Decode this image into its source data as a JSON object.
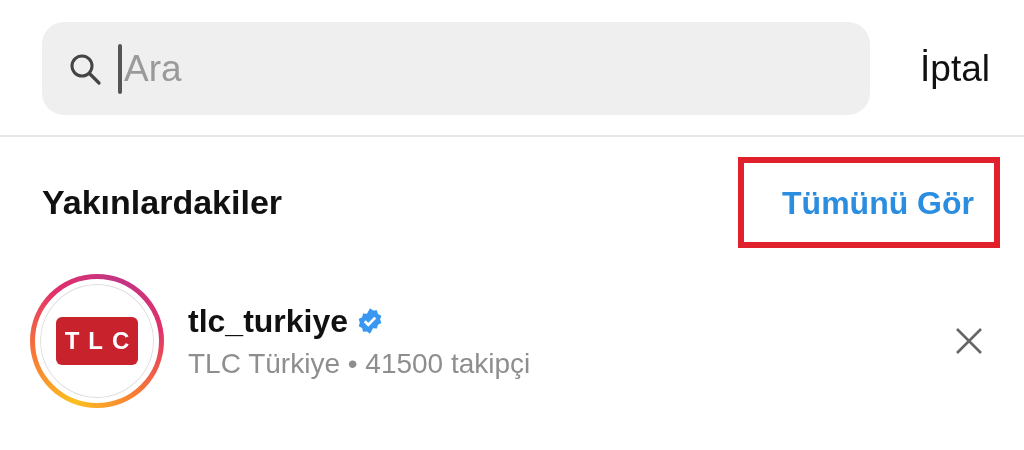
{
  "search": {
    "placeholder": "Ara",
    "cancel": "İptal"
  },
  "section": {
    "title": "Yakınlardakiler",
    "see_all": "Tümünü Gör",
    "see_all_highlighted": true
  },
  "results": [
    {
      "username": "tlc_turkiye",
      "verified": true,
      "logo_text": "TLC",
      "subtitle": "TLC Türkiye • 41500 takipçi",
      "has_story": true
    }
  ]
}
